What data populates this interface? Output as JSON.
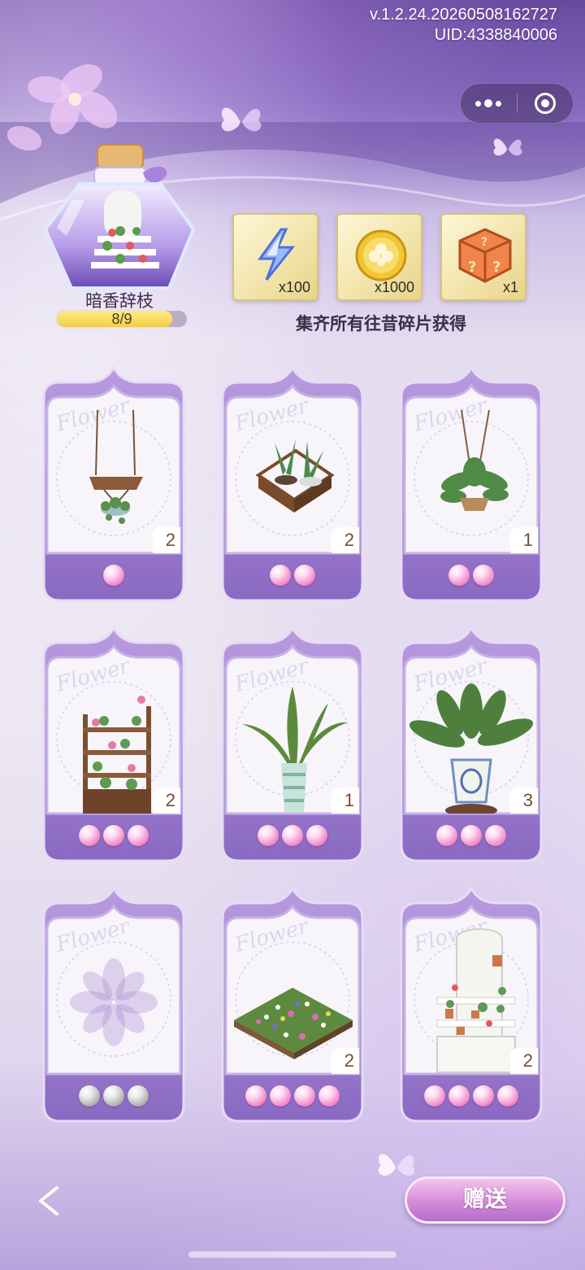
{
  "status": {
    "version": "v.1.2.24.20260508162727",
    "uid": "UID:4338840006"
  },
  "capsule": {
    "menu_icon": "more-dots-icon",
    "close_icon": "target-circle-icon"
  },
  "bottle": {
    "name": "暗香辞枝",
    "progress_text": "8/9",
    "progress_fraction": 0.889
  },
  "rewards": {
    "items": [
      {
        "icon": "lightning-icon",
        "qty": "x100"
      },
      {
        "icon": "gold-coin-icon",
        "qty": "x1000"
      },
      {
        "icon": "mystery-box-icon",
        "qty": "x1"
      }
    ],
    "caption": "集齐所有往昔碎片获得"
  },
  "cards": [
    {
      "item": "hanging-shelf-plant",
      "count": "2",
      "pearls": 1,
      "pearl_color": "pink"
    },
    {
      "item": "plant-terrarium",
      "count": "2",
      "pearls": 2,
      "pearl_color": "pink"
    },
    {
      "item": "hanging-fern-pot",
      "count": "1",
      "pearls": 2,
      "pearl_color": "pink"
    },
    {
      "item": "flower-display-shelf",
      "count": "2",
      "pearls": 3,
      "pearl_color": "pink"
    },
    {
      "item": "striped-vase-plant",
      "count": "1",
      "pearls": 3,
      "pearl_color": "pink"
    },
    {
      "item": "porcelain-pot-plant",
      "count": "3",
      "pearls": 3,
      "pearl_color": "pink"
    },
    {
      "item": "locked-empty",
      "count": "",
      "pearls": 3,
      "pearl_color": "gray"
    },
    {
      "item": "flower-bed",
      "count": "2",
      "pearls": 4,
      "pearl_color": "pink"
    },
    {
      "item": "white-cabinet-shelf",
      "count": "2",
      "pearls": 4,
      "pearl_color": "pink"
    }
  ],
  "footer": {
    "back_icon": "back-arrow-icon",
    "gift_label": "赠送"
  },
  "colors": {
    "card_purple": "#9b7cc9",
    "card_dark": "#7a5bb1",
    "pearl_pink": "#f17fc5",
    "gold": "#f4cf3c"
  }
}
